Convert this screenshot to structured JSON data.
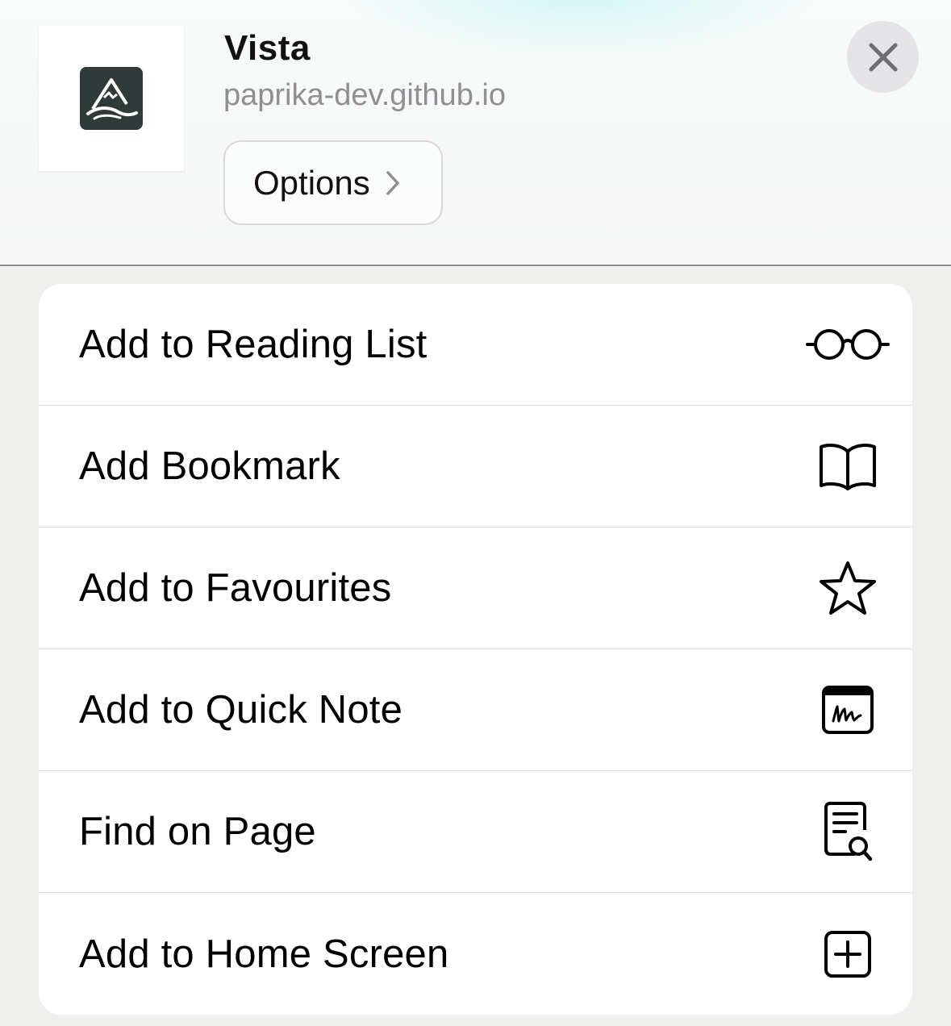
{
  "header": {
    "app_title": "Vista",
    "app_url": "paprika-dev.github.io",
    "options_label": "Options",
    "app_icon": "mountain-logo-icon",
    "close_icon": "close-icon"
  },
  "colors": {
    "logo_background": "#2f3b39",
    "secondary_text": "#8e8e93",
    "close_button_bg": "#e4e4e6"
  },
  "menu": {
    "items": [
      {
        "label": "Add to Reading List",
        "icon": "glasses-icon"
      },
      {
        "label": "Add Bookmark",
        "icon": "book-icon"
      },
      {
        "label": "Add to Favourites",
        "icon": "star-icon"
      },
      {
        "label": "Add to Quick Note",
        "icon": "quick-note-icon"
      },
      {
        "label": "Find on Page",
        "icon": "find-on-page-icon"
      },
      {
        "label": "Add to Home Screen",
        "icon": "add-square-icon"
      }
    ]
  }
}
